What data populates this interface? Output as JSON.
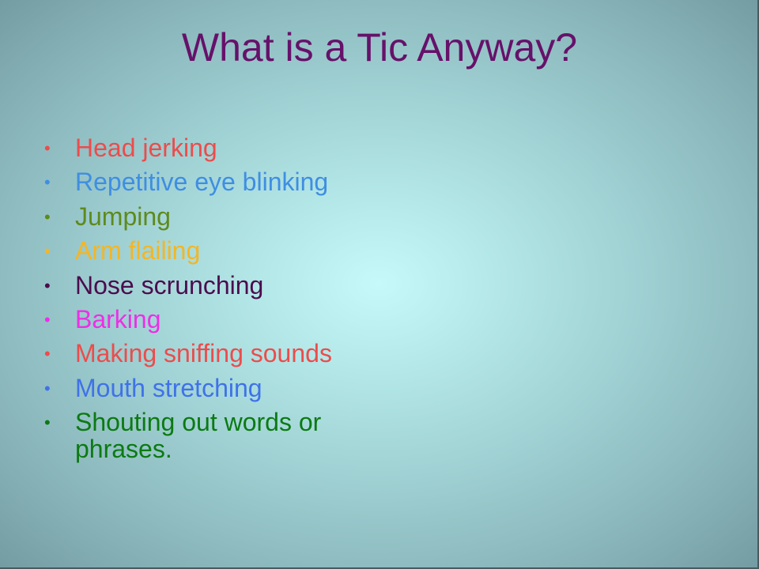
{
  "slide": {
    "title": "What is a Tic Anyway?",
    "title_color": "#66116a",
    "bullets": [
      {
        "text": "Head jerking",
        "color": "#ec4c4c"
      },
      {
        "text": "Repetitive eye blinking",
        "color": "#3f8ee2"
      },
      {
        "text": "Jumping",
        "color": "#5e8a1c"
      },
      {
        "text": "Arm flailing",
        "color": "#f2b628"
      },
      {
        "text": "Nose scrunching",
        "color": "#4b0c4d"
      },
      {
        "text": "Barking",
        "color": "#ee2ee6"
      },
      {
        "text": "Making sniffing sounds",
        "color": "#ec4c4c"
      },
      {
        "text": "Mouth stretching",
        "color": "#3f72e8"
      },
      {
        "text": "Shouting out words or phrases.",
        "color": "#0c7a12"
      }
    ],
    "bullet_glyph": "•"
  }
}
